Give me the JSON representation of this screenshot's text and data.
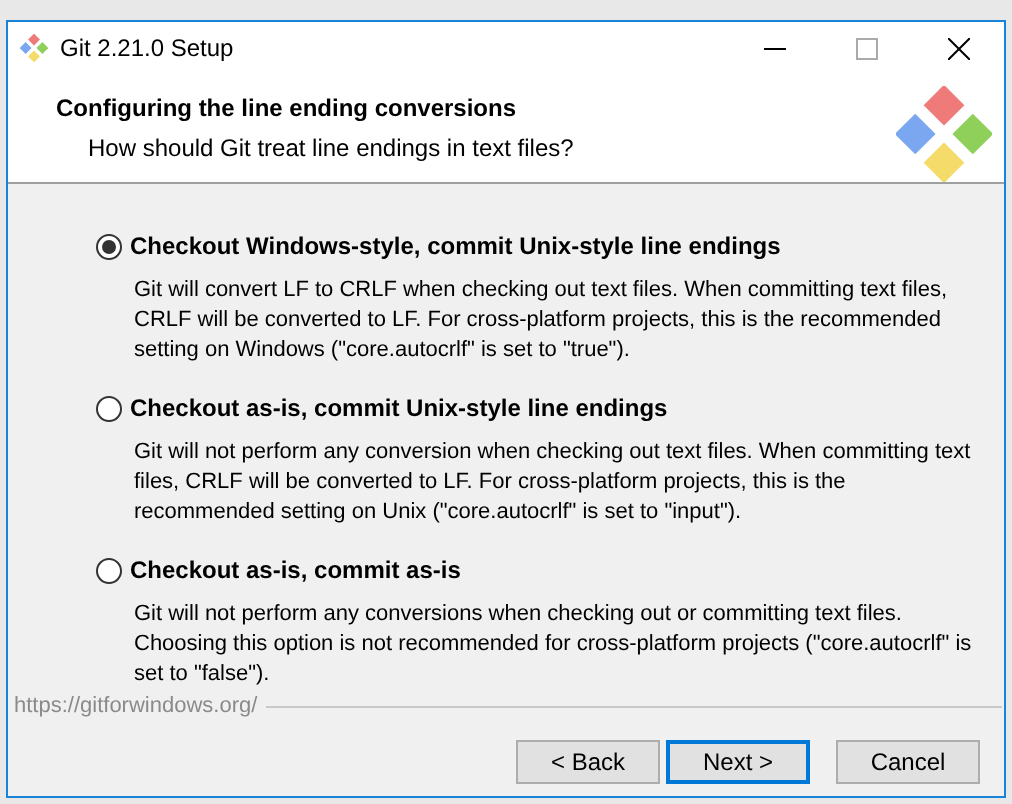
{
  "window": {
    "title": "Git 2.21.0 Setup"
  },
  "header": {
    "title": "Configuring the line ending conversions",
    "subtitle": "How should Git treat line endings in text files?"
  },
  "options": [
    {
      "label": "Checkout Windows-style, commit Unix-style line endings",
      "selected": true,
      "description": "Git will convert LF to CRLF when checking out text files. When committing text files, CRLF will be converted to LF. For cross-platform projects, this is the recommended setting on Windows (\"core.autocrlf\" is set to \"true\")."
    },
    {
      "label": "Checkout as-is, commit Unix-style line endings",
      "selected": false,
      "description": "Git will not perform any conversion when checking out text files. When committing text files, CRLF will be converted to LF. For cross-platform projects, this is the recommended setting on Unix (\"core.autocrlf\" is set to \"input\")."
    },
    {
      "label": "Checkout as-is, commit as-is",
      "selected": false,
      "description": "Git will not perform any conversions when checking out or committing text files. Choosing this option is not recommended for cross-platform projects (\"core.autocrlf\" is set to \"false\")."
    }
  ],
  "footer_link": "https://gitforwindows.org/",
  "buttons": [
    {
      "label": "< Back",
      "selected": false
    },
    {
      "label": "Next >",
      "selected": true
    },
    {
      "label": "Cancel",
      "selected": false
    }
  ]
}
